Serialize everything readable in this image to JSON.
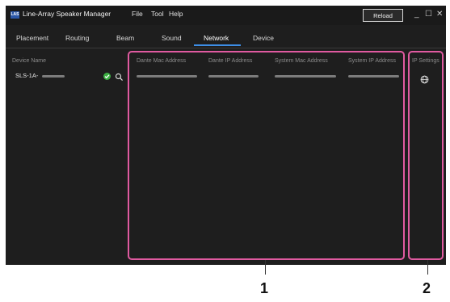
{
  "app": {
    "logo_text": "LAS",
    "title": "Line-Array Speaker Manager"
  },
  "menu": [
    "File",
    "Tool",
    "Help"
  ],
  "toolbar": {
    "reload_label": "Reload"
  },
  "window_controls": {
    "minimize": "_",
    "maximize": "☐",
    "close": "✕"
  },
  "tabs": [
    {
      "label": "Placement",
      "active": false
    },
    {
      "label": "Routing",
      "active": false
    },
    {
      "label": "Beam",
      "active": false
    },
    {
      "label": "Sound",
      "active": false
    },
    {
      "label": "Network",
      "active": true
    },
    {
      "label": "Device",
      "active": false
    }
  ],
  "table": {
    "columns": [
      "Device Name",
      "Dante Mac Address",
      "Dante IP Address",
      "System Mac Address",
      "System IP Address",
      "IP Settings"
    ],
    "rows": [
      {
        "device_name": "SLS-1A-",
        "status": "connected"
      }
    ]
  },
  "callouts": [
    "1",
    "2"
  ],
  "colors": {
    "accent": "#3d8ee6",
    "highlight": "#e05aa0",
    "status_ok": "#3cb043"
  },
  "icons": [
    "check-icon",
    "search-icon",
    "globe-icon"
  ]
}
